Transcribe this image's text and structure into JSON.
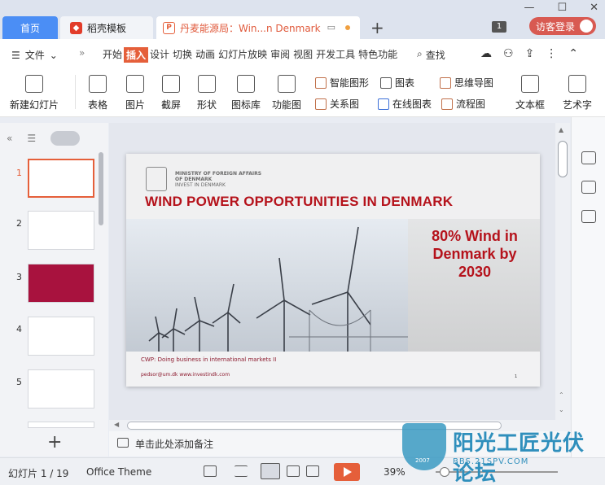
{
  "tabs": {
    "home": "首页",
    "daoke": "稻壳模板",
    "doc": "丹麦能源局：Win...n Denmark"
  },
  "header": {
    "badge": "1",
    "login": "访客登录"
  },
  "menu": {
    "file": "文件",
    "items": [
      "开始",
      "插入",
      "设计",
      "切换",
      "动画",
      "幻灯片放映",
      "审阅",
      "视图",
      "开发工具",
      "特色功能"
    ],
    "active": "插入",
    "search": "查找"
  },
  "ribbon": {
    "new_slide": "新建幻灯片",
    "table": "表格",
    "image": "图片",
    "screenshot": "截屏",
    "shape": "形状",
    "icon_lib": "图标库",
    "func_chart": "功能图",
    "smart_shape": "智能图形",
    "chart": "图表",
    "mind_map": "思维导图",
    "relation": "关系图",
    "online_chart": "在线图表",
    "flowchart": "流程图",
    "textbox": "文本框",
    "art_text": "艺术字"
  },
  "thumbnails": [
    "1",
    "2",
    "3",
    "4",
    "5"
  ],
  "slide": {
    "ministry": "MINISTRY OF FOREIGN AFFAIRS OF DENMARK",
    "ministry_sub": "INVEST IN DENMARK",
    "title": "WIND POWER OPPORTUNITIES IN DENMARK",
    "right_line1": "80% Wind in",
    "right_line2": "Denmark by",
    "right_line3": "2030",
    "footer1": "CWP:  Doing business in international markets II",
    "footer2": "pedsor@um.dk www.investindk.com",
    "page": "1"
  },
  "notes": {
    "placeholder": "单击此处添加备注"
  },
  "status": {
    "slide_info": "幻灯片 1 / 19",
    "theme": "Office Theme",
    "zoom": "39%"
  },
  "watermark": {
    "text": "阳光工匠光伏论坛",
    "url": "BBS.21SPV.COM",
    "year": "2007"
  }
}
